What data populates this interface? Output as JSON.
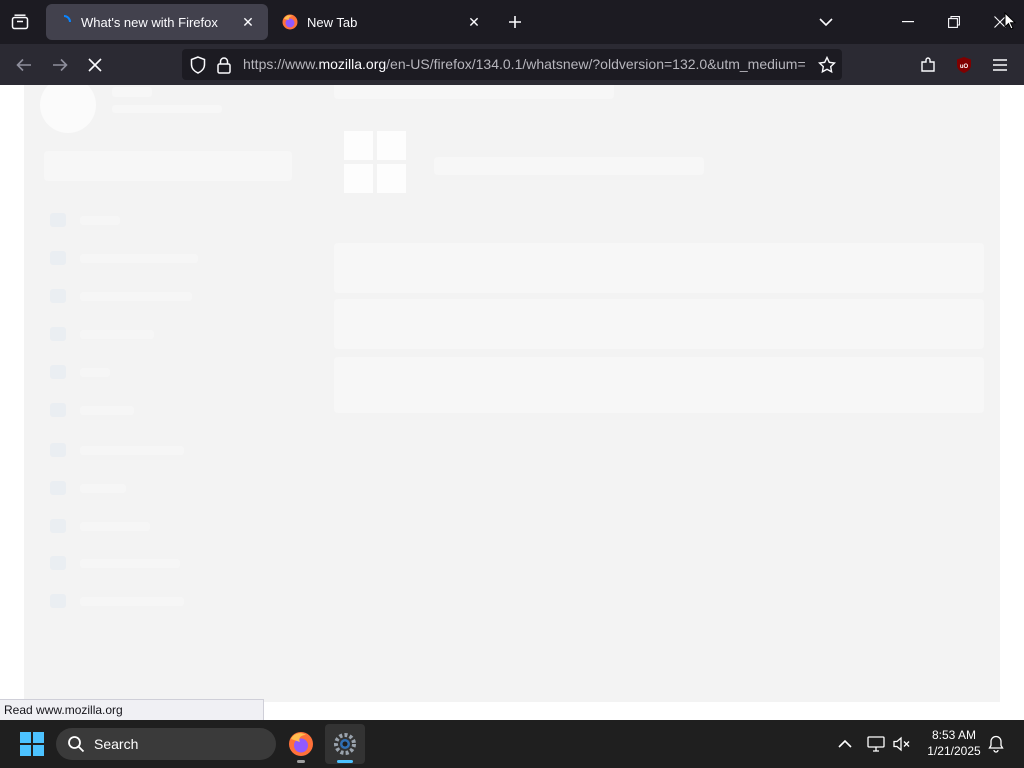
{
  "browser": {
    "tabs": [
      {
        "title": "What's new with Firefox",
        "active": true
      },
      {
        "title": "New Tab",
        "active": false
      }
    ],
    "url_prefix": "https://www.",
    "url_domain": "mozilla.org",
    "url_path": "/en-US/firefox/134.0.1/whatsnew/?oldversion=132.0&utm_medium=",
    "status_text": "Read www.mozilla.org",
    "colors": {
      "chrome_dark": "#1c1b22",
      "toolbar": "#2b2a33",
      "active_tab": "#42414d",
      "ublock": "#800000"
    },
    "icons": [
      "tab-list-icon",
      "firefox-icon",
      "close-tab-icon",
      "plus-icon",
      "chevron-down-icon",
      "minimize-icon",
      "restore-icon",
      "close-window-icon",
      "back-arrow-icon",
      "forward-arrow-icon",
      "stop-icon",
      "shield-icon",
      "lock-icon",
      "star-icon",
      "extensions-icon",
      "ublock-origin-icon",
      "hamburger-menu-icon"
    ]
  },
  "taskbar": {
    "search_placeholder": "Search",
    "time": "8:53 AM",
    "date": "1/21/2025",
    "icons": [
      "windows-start-icon",
      "search-icon",
      "firefox-taskbar-icon",
      "settings-taskbar-icon",
      "chevron-up-icon",
      "network-icon",
      "volume-muted-icon",
      "notification-bell-icon"
    ]
  }
}
